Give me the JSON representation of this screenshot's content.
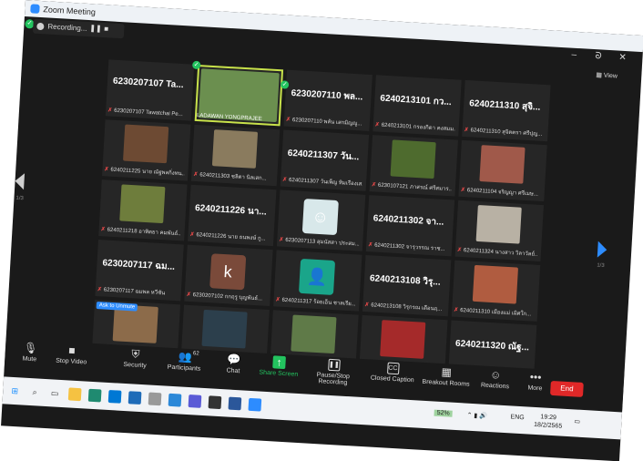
{
  "window": {
    "title": "Zoom Meeting",
    "view_label": "View",
    "minimize": "–",
    "restore": "ᘐ",
    "close": "✕"
  },
  "recording": {
    "label": "Recording...",
    "pause": "❚❚",
    "stop": "■"
  },
  "page_left": "1/3",
  "page_right": "1/3",
  "tiles": [
    {
      "big": "6230207107 Ta...",
      "sub": "6230207107 Tawatchai Pe..."
    },
    {
      "video_name": "LADAWAN YONGPRAJEE",
      "active": true,
      "color": "#6b8f4f"
    },
    {
      "big": "6230207110 พล...",
      "sub": "6230207110 พลัน เสกมิญญู..."
    },
    {
      "big": "6240213101 กว...",
      "sub": "6240213101 กรองกิดา คงสมม..."
    },
    {
      "big": "6240211310 สุจิ...",
      "sub": "6240211310 สุจิตตรา ศรีปุญ..."
    },
    {
      "sub": "6240211225 นาย ณัฐพลกิ่งทน...",
      "color": "#6d4a33"
    },
    {
      "sub": "6240211303 ชลิตา นิลเสก...",
      "color": "#8a7b5e"
    },
    {
      "big": "6240211307 วัน...",
      "sub": "6240211307 วันเพ็ญ ทิมเรืองเส..."
    },
    {
      "sub": "6230107121 ภาสรณ์ ศรีสมาร...",
      "color": "#4e6b2e"
    },
    {
      "sub": "6240211104 จริญญา ศรีเมษ...",
      "color": "#a0594a"
    },
    {
      "sub": "6240211218 อาทิตยา คมพันธ์...",
      "color": "#6e7d3c"
    },
    {
      "big": "6240211226 นา...",
      "sub": "6240211226 นาย ธนพงษ์ กู..."
    },
    {
      "sub": "6230207113 สุมนัสสา ประสม...",
      "avatar": "cartoon",
      "color": "#d8e8ea"
    },
    {
      "big": "6240211302 จา...",
      "sub": "6240211302 จารุวรรณ ราช..."
    },
    {
      "sub": "6240211324 นางสาว วิลาวัลย์...",
      "color": "#b8b1a4"
    },
    {
      "big": "6230207117 ฉม...",
      "sub": "6230207117 ฉมพล หวีชัน"
    },
    {
      "sub": "6230207102 กกฤรู บุญพันธ์...",
      "letter": "k",
      "color": "#7a4a3a"
    },
    {
      "sub": "6240211317 ร้อยเอ็น ชาลเรีย...",
      "avatar": "person",
      "color": "#1aa58a"
    },
    {
      "big": "6240213108 วิรุ...",
      "sub": "6240213108 วิรุกรณ เดือนฤ..."
    },
    {
      "sub": "6240211310 เมืองแม่ เมิศใก...",
      "color": "#b05c40"
    },
    {
      "sub": "6230207120 นายวัชรพงษ์ สะ...",
      "unmute": "Ask to Unmute",
      "color": "#8c6b4a"
    },
    {
      "sub": "6240211318 ปาลริก บุญดง...",
      "color": "#2c3f4c"
    },
    {
      "sub": "6240211254 วุฒิชนันท์ ทอง...",
      "color": "#5f7a48"
    },
    {
      "sub": "6240211241 นางพาวัน ตำรา...",
      "color": "#a52a2a"
    },
    {
      "big": "6240211320 ณัฐ...",
      "sub": "6240211320 ณัฐกิตต สุกร..."
    }
  ],
  "toolbar": {
    "mute": "Mute",
    "stop_video": "Stop Video",
    "security": "Security",
    "participants": "Participants",
    "participants_count": "62",
    "chat": "Chat",
    "share_screen": "Share Screen",
    "pause_stop": "Pause/Stop Recording",
    "closed_caption": "Closed Caption",
    "breakout": "Breakout Rooms",
    "reactions": "Reactions",
    "more": "More",
    "end": "End",
    "cc_icon": "CC"
  },
  "taskbar": {
    "battery": "52%",
    "lang": "ENG",
    "time": "19:29",
    "date": "18/2/2565"
  },
  "colors": {
    "zoom_blue": "#2d8cff",
    "share_green": "#23c35f",
    "end_red": "#e02828"
  }
}
